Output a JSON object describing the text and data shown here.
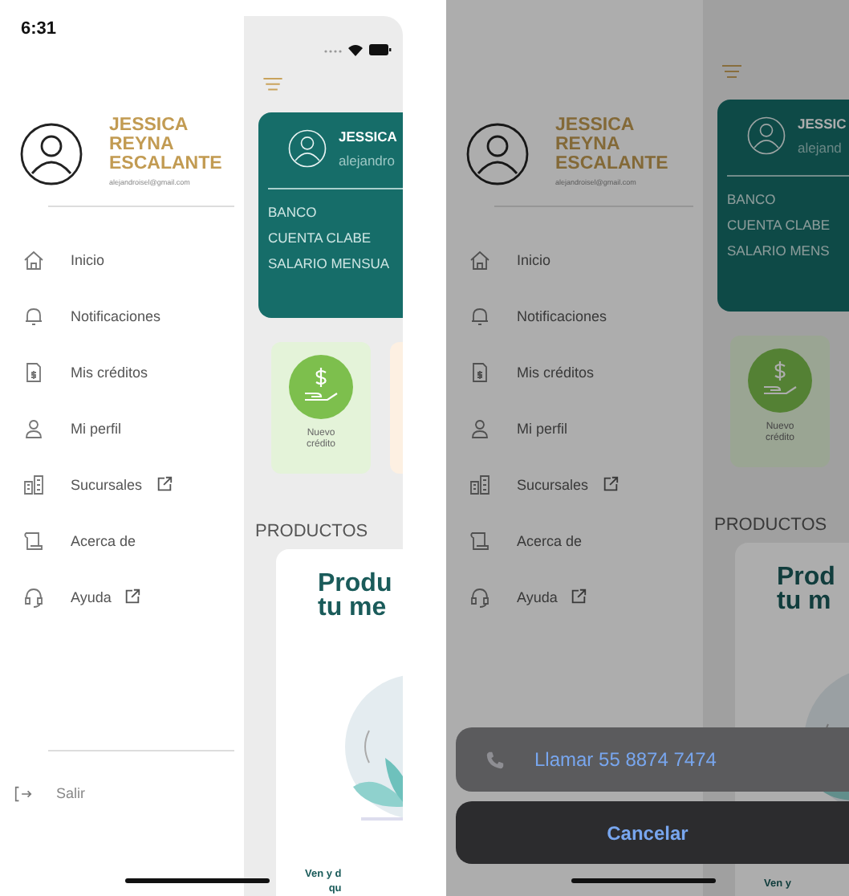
{
  "screens": [
    {
      "status_time": "6:31",
      "drawer": {
        "name_lines": [
          "JESSICA",
          "REYNA",
          "ESCALANTE"
        ],
        "email": "alejandroisel@gmail.com",
        "menu": [
          {
            "label": "Inicio",
            "external": false
          },
          {
            "label": "Notificaciones",
            "external": false
          },
          {
            "label": "Mis créditos",
            "external": false
          },
          {
            "label": "Mi perfil",
            "external": false
          },
          {
            "label": "Sucursales",
            "external": true
          },
          {
            "label": "Acerca de",
            "external": false
          },
          {
            "label": "Ayuda",
            "external": true
          }
        ],
        "logout": "Salir"
      },
      "home": {
        "card": {
          "name": "JESSICA",
          "email": "alejandro",
          "fields": [
            "BANCO",
            "CUENTA CLABE",
            "SALARIO MENSUA"
          ]
        },
        "quick_action": {
          "label_lines": [
            "Nuevo",
            "crédito"
          ]
        },
        "section_title": "PRODUCTOS",
        "product": {
          "title_lines": [
            "Produ",
            "tu me"
          ],
          "caption_lines": [
            "Ven y d",
            "qu"
          ]
        }
      }
    },
    {
      "drawer": {
        "name_lines": [
          "JESSICA",
          "REYNA",
          "ESCALANTE"
        ],
        "email": "alejandroisel@gmail.com",
        "menu": [
          {
            "label": "Inicio",
            "external": false
          },
          {
            "label": "Notificaciones",
            "external": false
          },
          {
            "label": "Mis créditos",
            "external": false
          },
          {
            "label": "Mi perfil",
            "external": false
          },
          {
            "label": "Sucursales",
            "external": true
          },
          {
            "label": "Acerca de",
            "external": false
          },
          {
            "label": "Ayuda",
            "external": true
          }
        ]
      },
      "home": {
        "card": {
          "name": "JESSIC",
          "email": "alejand",
          "fields": [
            "BANCO",
            "CUENTA CLABE",
            "SALARIO MENS"
          ]
        },
        "quick_action": {
          "label_lines": [
            "Nuevo",
            "crédito"
          ]
        },
        "section_title": "PRODUCTOS",
        "product": {
          "title_lines": [
            "Prod",
            "tu m"
          ],
          "caption_lines": [
            "Ven y"
          ]
        }
      },
      "action_sheet": {
        "action": "Llamar 55 8874 7474",
        "cancel": "Cancelar"
      }
    }
  ]
}
